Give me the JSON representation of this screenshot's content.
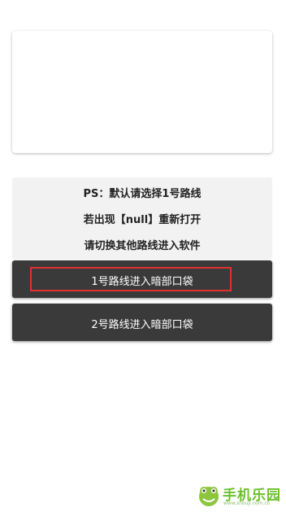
{
  "card": {},
  "notice": {
    "line1": "PS：默认请选择1号路线",
    "line2": "若出现【null】重新打开",
    "line3": "请切换其他路线进入软件"
  },
  "buttons": [
    {
      "label": "1号路线进入暗部口袋",
      "highlighted": true
    },
    {
      "label": "2号路线进入暗部口袋",
      "highlighted": false
    }
  ],
  "watermark": {
    "text": "手机乐园",
    "url": "www.shouji.com.cn",
    "logo_icon": "frog-logo-icon"
  },
  "colors": {
    "button_bg": "#3a3a3a",
    "notice_bg": "#f2f2f2",
    "highlight": "#e0312e",
    "watermark": "#6cc02f"
  }
}
